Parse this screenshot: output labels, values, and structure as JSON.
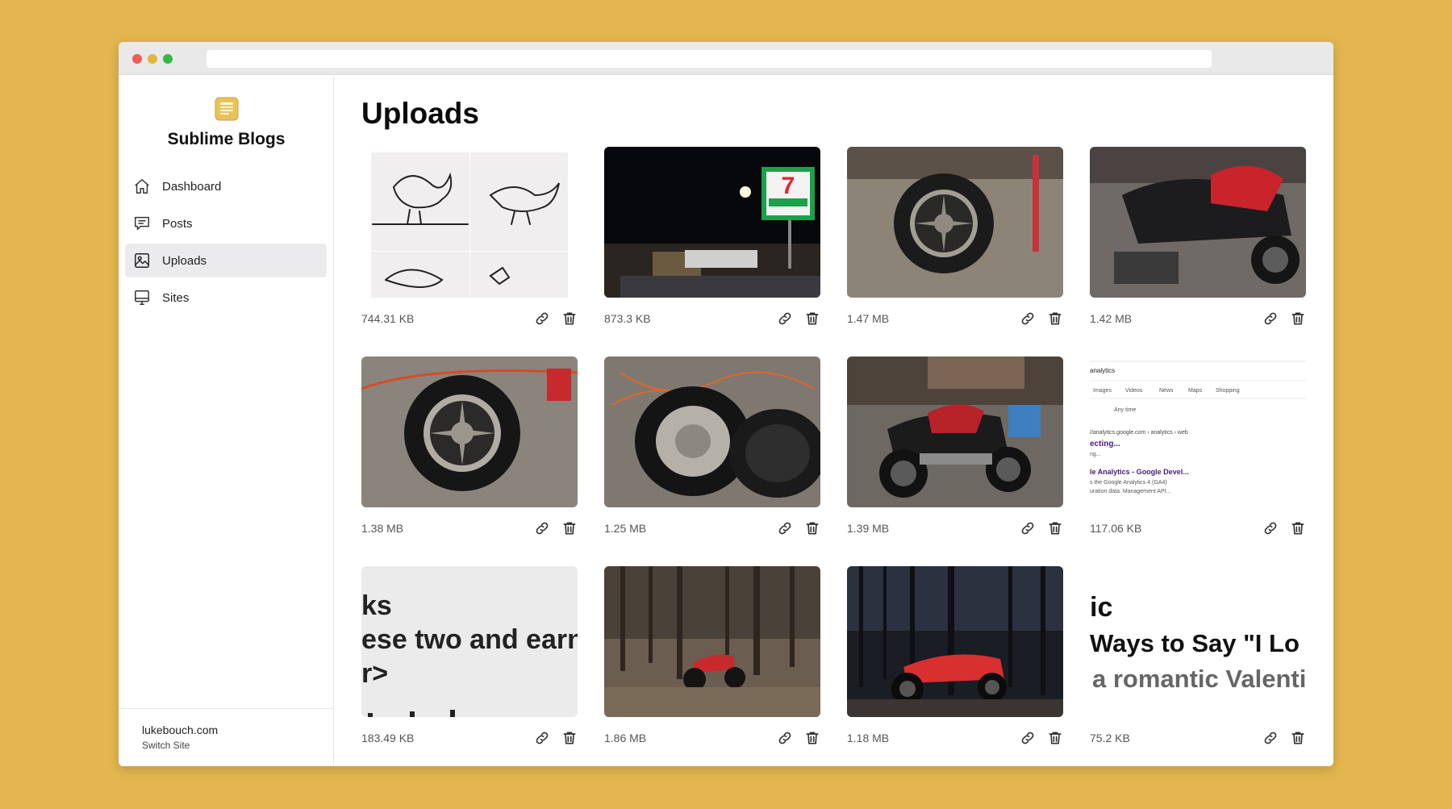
{
  "app": {
    "name": "Sublime Blogs"
  },
  "nav": [
    {
      "label": "Dashboard",
      "icon": "home-icon",
      "active": false
    },
    {
      "label": "Posts",
      "icon": "chat-icon",
      "active": false
    },
    {
      "label": "Uploads",
      "icon": "image-icon",
      "active": true
    },
    {
      "label": "Sites",
      "icon": "monitor-icon",
      "active": false
    }
  ],
  "footer": {
    "domain": "lukebouch.com",
    "switch_label": "Switch Site"
  },
  "page": {
    "title": "Uploads"
  },
  "uploads": [
    {
      "size": "744.31 KB",
      "thumb": "bird-sketches"
    },
    {
      "size": "873.3 KB",
      "thumb": "7-eleven-night"
    },
    {
      "size": "1.47 MB",
      "thumb": "wheel-garage"
    },
    {
      "size": "1.42 MB",
      "thumb": "motorcycle-garage"
    },
    {
      "size": "1.38 MB",
      "thumb": "wheel-floor"
    },
    {
      "size": "1.25 MB",
      "thumb": "wheel-tire"
    },
    {
      "size": "1.39 MB",
      "thumb": "motorcycle-side"
    },
    {
      "size": "117.06 KB",
      "thumb": "search-screenshot"
    },
    {
      "size": "183.49 KB",
      "thumb": "text-screenshot"
    },
    {
      "size": "1.86 MB",
      "thumb": "motorcycle-forest"
    },
    {
      "size": "1.18 MB",
      "thumb": "motorcycle-night-forest"
    },
    {
      "size": "75.2 KB",
      "thumb": "valentine-screenshot"
    }
  ],
  "thumb_text": {
    "search": {
      "header": "analytics",
      "tabs": [
        "Images",
        "Videos",
        "News",
        "Maps",
        "Shopping"
      ],
      "filter": "Any time",
      "url": "//analytics.google.com › analytics › web",
      "r1": "ecting...",
      "r1b": "ng...",
      "r2": "le Analytics - Google Devel...",
      "r2a": "s the Google Analytics 4 (GA4)",
      "r2b": "uration data. Management API..."
    },
    "text_shot": {
      "l1": "ks",
      "l2": "ese two and earn",
      "l3": "r>"
    },
    "valentine": {
      "l1": "ic",
      "l2": "Ways to Say \"I Lo",
      "l3": "a romantic Valenti"
    }
  },
  "colors": {
    "background": "#e3b64f",
    "active_nav": "#ebebee",
    "brand": "#e7c35a"
  }
}
